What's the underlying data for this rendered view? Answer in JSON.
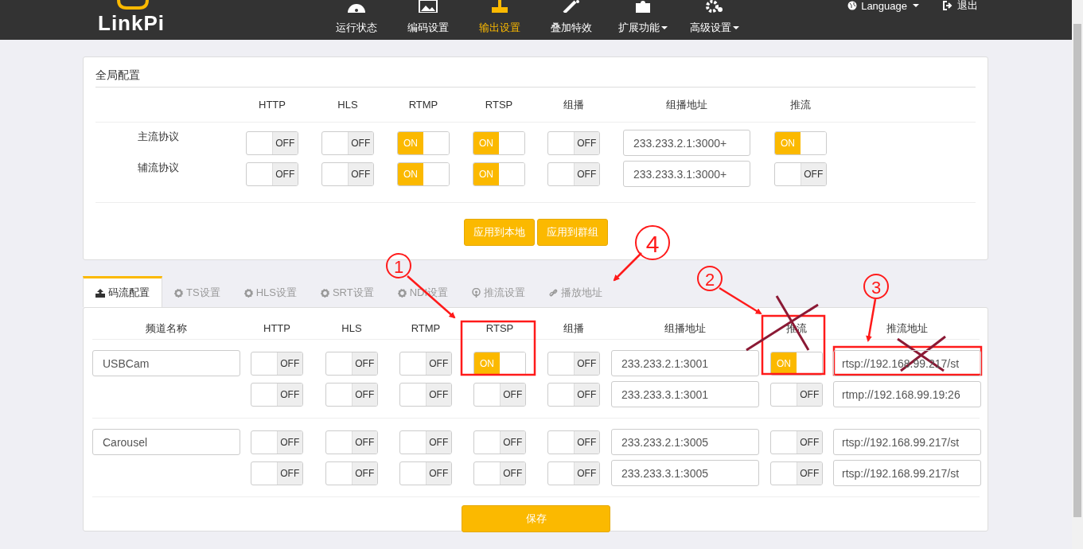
{
  "nav": {
    "logo": "LinkPi",
    "items": [
      {
        "label": "运行状态",
        "selected": false,
        "dropdown": false
      },
      {
        "label": "编码设置",
        "selected": false,
        "dropdown": false
      },
      {
        "label": "输出设置",
        "selected": true,
        "dropdown": false
      },
      {
        "label": "叠加特效",
        "selected": false,
        "dropdown": false
      },
      {
        "label": "扩展功能",
        "selected": false,
        "dropdown": true
      },
      {
        "label": "高级设置",
        "selected": false,
        "dropdown": true
      }
    ],
    "language": "Language",
    "logout": "退出"
  },
  "global": {
    "title": "全局配置",
    "columns": [
      "HTTP",
      "HLS",
      "RTMP",
      "RTSP",
      "组播",
      "组播地址",
      "推流"
    ],
    "rows": [
      {
        "label": "主流协议",
        "switches": [
          {
            "text": "OFF",
            "on": false
          },
          {
            "text": "OFF",
            "on": false
          },
          {
            "text": "ON",
            "on": true
          },
          {
            "text": "ON",
            "on": true
          },
          {
            "text": "OFF",
            "on": false
          }
        ],
        "multicast_address": "233.233.2.1:3000+",
        "push": {
          "text": "ON",
          "on": true
        }
      },
      {
        "label": "辅流协议",
        "switches": [
          {
            "text": "OFF",
            "on": false
          },
          {
            "text": "OFF",
            "on": false
          },
          {
            "text": "ON",
            "on": true
          },
          {
            "text": "ON",
            "on": true
          },
          {
            "text": "OFF",
            "on": false
          }
        ],
        "multicast_address": "233.233.3.1:3000+",
        "push": {
          "text": "OFF",
          "on": false
        }
      }
    ],
    "buttons": [
      "应用到本地",
      "应用到群组"
    ]
  },
  "tabs": [
    {
      "label": "码流配置",
      "selected": true
    },
    {
      "label": "TS设置",
      "selected": false
    },
    {
      "label": "HLS设置",
      "selected": false
    },
    {
      "label": "SRT设置",
      "selected": false
    },
    {
      "label": "NDI设置",
      "selected": false
    },
    {
      "label": "推流设置",
      "selected": false
    },
    {
      "label": "播放地址",
      "selected": false
    }
  ],
  "stream_table": {
    "columns": [
      "频道名称",
      "HTTP",
      "HLS",
      "RTMP",
      "RTSP",
      "组播",
      "组播地址",
      "推流",
      "推流地址"
    ],
    "channels": [
      {
        "name": "USBCam",
        "streams": [
          {
            "switches": [
              {
                "text": "OFF",
                "on": false
              },
              {
                "text": "OFF",
                "on": false
              },
              {
                "text": "OFF",
                "on": false
              },
              {
                "text": "ON",
                "on": true
              },
              {
                "text": "OFF",
                "on": false
              }
            ],
            "multicast_address": "233.233.2.1:3001",
            "push": {
              "text": "ON",
              "on": true
            },
            "push_address": "rtsp://192.168.99.217/st"
          },
          {
            "switches": [
              {
                "text": "OFF",
                "on": false
              },
              {
                "text": "OFF",
                "on": false
              },
              {
                "text": "OFF",
                "on": false
              },
              {
                "text": "OFF",
                "on": false
              },
              {
                "text": "OFF",
                "on": false
              }
            ],
            "multicast_address": "233.233.3.1:3001",
            "push": {
              "text": "OFF",
              "on": false
            },
            "push_address": "rtmp://192.168.99.19:26"
          }
        ]
      },
      {
        "name": "Carousel",
        "streams": [
          {
            "switches": [
              {
                "text": "OFF",
                "on": false
              },
              {
                "text": "OFF",
                "on": false
              },
              {
                "text": "OFF",
                "on": false
              },
              {
                "text": "OFF",
                "on": false
              },
              {
                "text": "OFF",
                "on": false
              }
            ],
            "multicast_address": "233.233.2.1:3005",
            "push": {
              "text": "OFF",
              "on": false
            },
            "push_address": "rtsp://192.168.99.217/st"
          },
          {
            "switches": [
              {
                "text": "OFF",
                "on": false
              },
              {
                "text": "OFF",
                "on": false
              },
              {
                "text": "OFF",
                "on": false
              },
              {
                "text": "OFF",
                "on": false
              },
              {
                "text": "OFF",
                "on": false
              }
            ],
            "multicast_address": "233.233.3.1:3005",
            "push": {
              "text": "OFF",
              "on": false
            },
            "push_address": "rtsp://192.168.99.217/st"
          }
        ]
      }
    ],
    "save": "保存"
  },
  "annotations": [
    {
      "label": "1"
    },
    {
      "label": "2"
    },
    {
      "label": "3"
    },
    {
      "label": "4"
    }
  ]
}
